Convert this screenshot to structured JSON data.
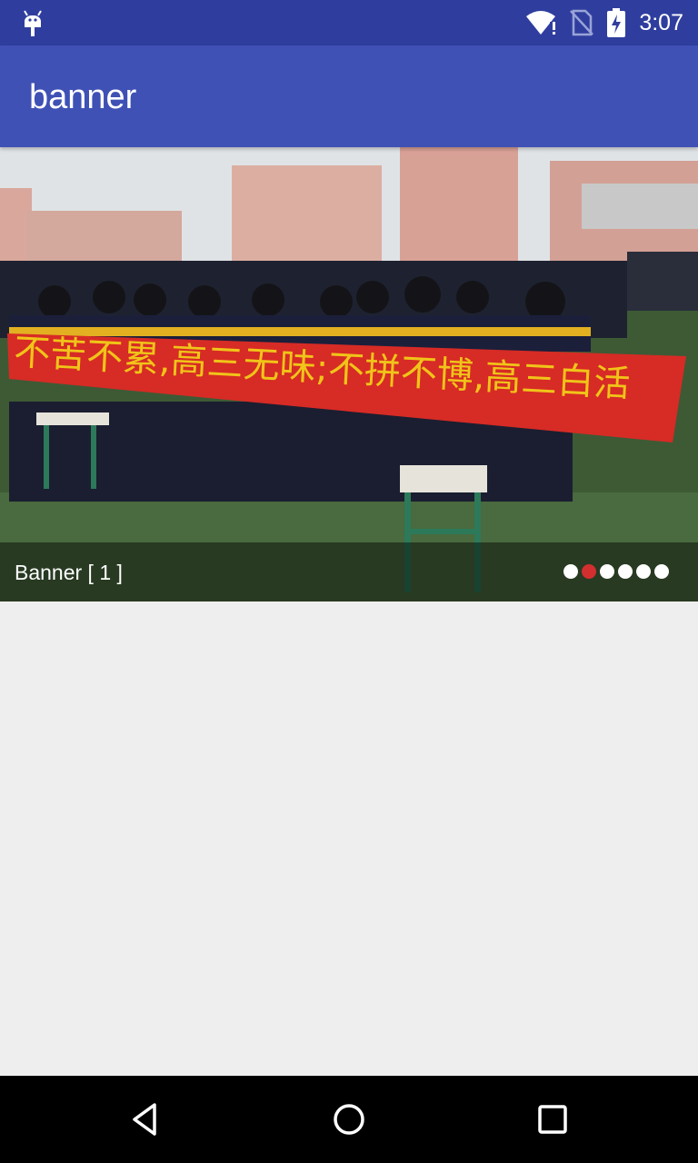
{
  "status_bar": {
    "time": "3:07",
    "bg_color": "#2f3e9e",
    "icons": [
      "android-debug-icon",
      "wifi-alert-icon",
      "no-sim-icon",
      "battery-charging-icon"
    ]
  },
  "app_bar": {
    "title": "banner",
    "bg_color": "#3f51b5"
  },
  "banner": {
    "caption": "Banner [ 1 ]",
    "image_description_icon": "banner-photo",
    "photo_banner_text": "不苦不累,高三无味;不拼不博,高三白活",
    "indicator_count": 6,
    "active_indicator": 2,
    "indicator_active_color": "#d32f2f"
  },
  "nav_bar": {
    "buttons": [
      "back-icon",
      "home-icon",
      "recents-icon"
    ]
  }
}
